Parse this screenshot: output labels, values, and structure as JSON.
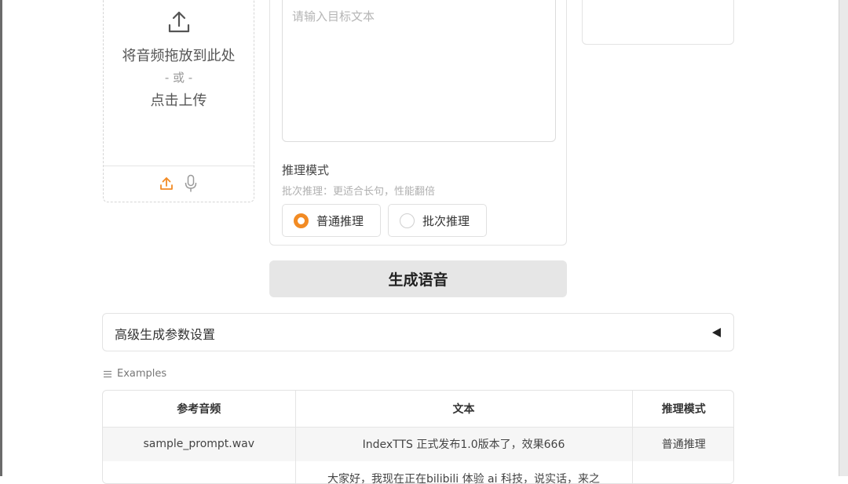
{
  "upload": {
    "drop_text": "将音频拖放到此处",
    "or_text": "- 或 -",
    "click_text": "点击上传",
    "icons": [
      "upload-arrow-icon",
      "upload-icon",
      "microphone-icon"
    ]
  },
  "text_panel": {
    "placeholder": "请输入目标文本",
    "mode_label": "推理模式",
    "mode_hint": "批次推理：更适合长句，性能翻倍",
    "options": [
      "普通推理",
      "批次推理"
    ],
    "selected": "普通推理"
  },
  "generate_button": "生成语音",
  "advanced": {
    "title": "高级生成参数设置",
    "state": "collapsed"
  },
  "examples": {
    "label": "Examples",
    "columns": [
      "参考音频",
      "文本",
      "推理模式"
    ],
    "rows": [
      [
        "sample_prompt.wav",
        "IndexTTS 正式发布1.0版本了，效果666",
        "普通推理"
      ],
      [
        "",
        "大家好，我现在正在bilibili 体验 ai 科技，说实话，来之",
        ""
      ]
    ]
  },
  "colors": {
    "accent": "#f28b24",
    "button_bg": "#e6e6e6",
    "border": "#e3e3e3"
  }
}
